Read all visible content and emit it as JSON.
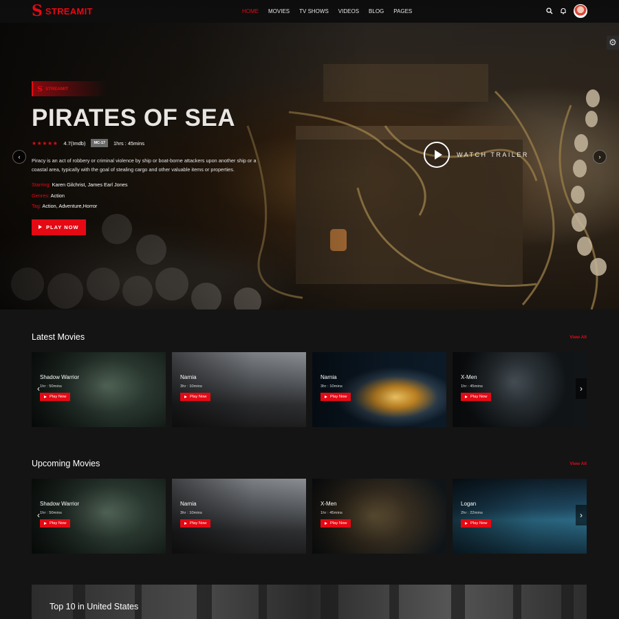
{
  "header": {
    "logo_mark": "S",
    "logo_text": "STREAMIT",
    "nav": [
      "HOME",
      "MOVIES",
      "TV SHOWS",
      "VIDEOS",
      "BLOG",
      "PAGES"
    ],
    "active_nav": "HOME"
  },
  "hero": {
    "tag_mark": "S",
    "tag_text": "STREAMIT",
    "title": "PIRATES OF SEA",
    "stars": "★★★★★",
    "rating": "4.7(Imdb)",
    "age_rating": "MC-17",
    "duration": "1hrs : 45mins",
    "description": "Piracy is an act of robbery or criminal violence by ship or boat-borne attackers upon another ship or a coastal area, typically with the goal of stealing cargo and other valuable items or properties.",
    "starring_label": "Starring:",
    "starring": "Karen Gilchrist, James Earl Jones",
    "genres_label": "Genres:",
    "genres": "Action",
    "tag_label": "Tag:",
    "tags": "Action, Adventure,Horror",
    "play_label": "PLAY NOW",
    "trailer_label": "WATCH TRAILER"
  },
  "latest": {
    "title": "Latest Movies",
    "view_all": "View All",
    "items": [
      {
        "title": "Shadow Warrior",
        "duration": "1hr : 50mins",
        "button": "Play Now"
      },
      {
        "title": "Narnia",
        "duration": "3hr : 10mins",
        "button": "Play Now"
      },
      {
        "title": "Narnia",
        "duration": "3hr : 10mins",
        "button": "Play Now"
      },
      {
        "title": "X-Men",
        "duration": "1hr : 45mins",
        "button": "Play Now"
      }
    ]
  },
  "upcoming": {
    "title": "Upcoming Movies",
    "view_all": "View All",
    "items": [
      {
        "title": "Shadow Warrior",
        "duration": "1hr : 50mins",
        "button": "Play Now"
      },
      {
        "title": "Narnia",
        "duration": "3hr : 10mins",
        "button": "Play Now"
      },
      {
        "title": "X-Men",
        "duration": "1hr : 45mins",
        "button": "Play Now"
      },
      {
        "title": "Logan",
        "duration": "2hr : 22mins",
        "button": "Play Now"
      }
    ]
  },
  "top10": {
    "title": "Top 10 in United States"
  },
  "colors": {
    "accent": "#e50914",
    "background": "#141414"
  }
}
